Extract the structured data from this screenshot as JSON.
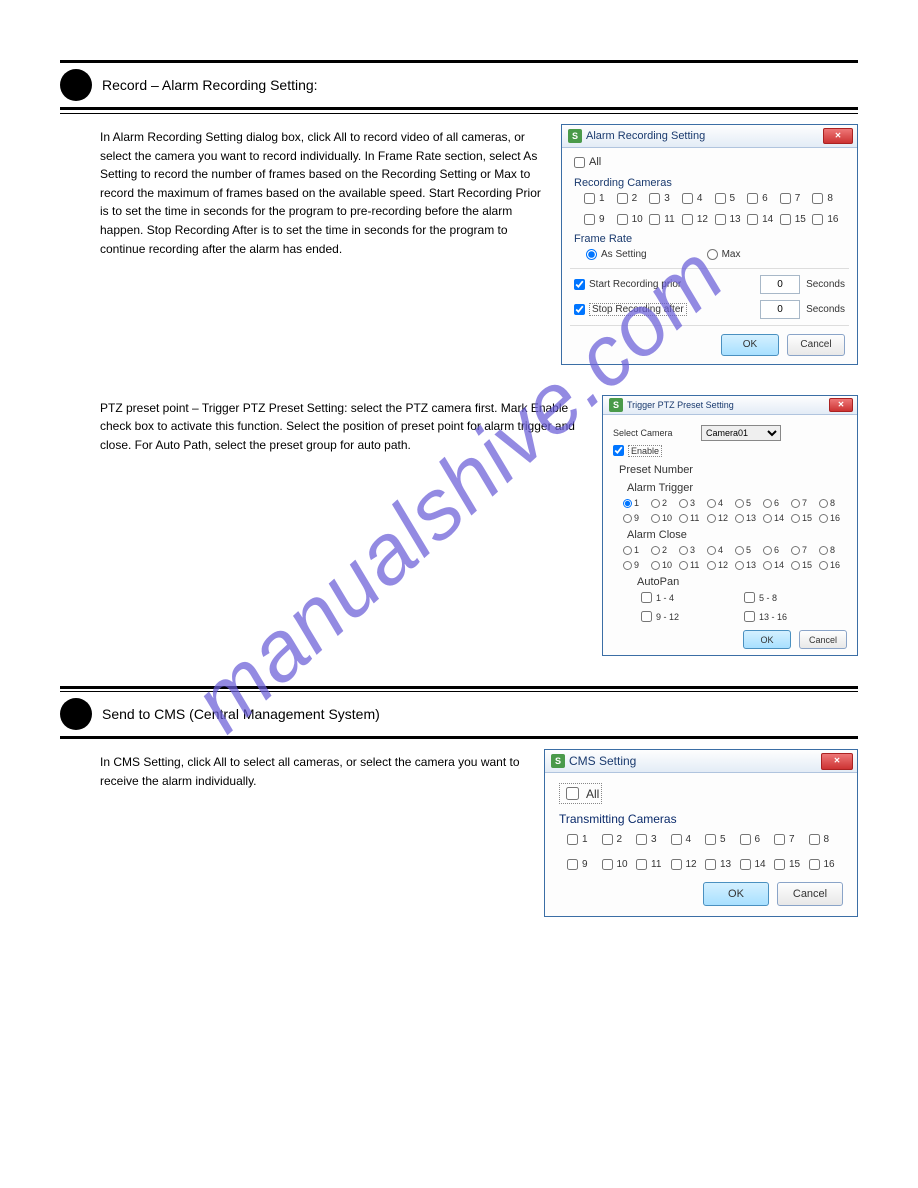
{
  "section1": {
    "title": "Record – Alarm Recording Setting:",
    "body": "In Alarm Recording Setting dialog box, click All to record video of all cameras, or select the camera you want to record individually. In Frame Rate section, select As Setting to record the number of frames based on the Recording Setting or Max to record the maximum of frames based on the available speed. Start Recording Prior is to set the time in seconds for the program to pre-recording before the alarm happen. Stop Recording After is to set the time in seconds for the program to continue recording after the alarm has ended."
  },
  "dlg1": {
    "title": "Alarm Recording Setting",
    "all": "All",
    "rec_cams": "Recording Cameras",
    "cams": [
      "1",
      "2",
      "3",
      "4",
      "5",
      "6",
      "7",
      "8",
      "9",
      "10",
      "11",
      "12",
      "13",
      "14",
      "15",
      "16"
    ],
    "frame_rate": "Frame Rate",
    "as_setting": "As Setting",
    "max": "Max",
    "start_prior": "Start Recording prior",
    "stop_after": "Stop Recording after",
    "start_val": "0",
    "stop_val": "0",
    "seconds": "Seconds",
    "ok": "OK",
    "cancel": "Cancel"
  },
  "ptz": {
    "body": "PTZ preset point – Trigger PTZ Preset Setting: select the PTZ camera first. Mark Enable check box to activate this function. Select the position of preset point for alarm trigger and close. For Auto Path, select the preset group for auto path."
  },
  "dlg2": {
    "title": "Trigger PTZ Preset Setting",
    "select_cam": "Select Camera",
    "cam_value": "Camera01",
    "enable": "Enable",
    "preset_num": "Preset Number",
    "alarm_trigger": "Alarm Trigger",
    "alarm_close": "Alarm Close",
    "nums": [
      "1",
      "2",
      "3",
      "4",
      "5",
      "6",
      "7",
      "8",
      "9",
      "10",
      "11",
      "12",
      "13",
      "14",
      "15",
      "16"
    ],
    "autopan": "AutoPan",
    "ap": [
      "1 - 4",
      "5 - 8",
      "9 - 12",
      "13 - 16"
    ],
    "ok": "OK",
    "cancel": "Cancel"
  },
  "section2": {
    "title": "Send to CMS (Central Management System)",
    "body": "In CMS Setting, click All to select all cameras, or select the camera you want to receive the alarm individually."
  },
  "dlg3": {
    "title": "CMS Setting",
    "all": "All",
    "trans": "Transmitting Cameras",
    "cams": [
      "1",
      "2",
      "3",
      "4",
      "5",
      "6",
      "7",
      "8",
      "9",
      "10",
      "11",
      "12",
      "13",
      "14",
      "15",
      "16"
    ],
    "ok": "OK",
    "cancel": "Cancel"
  },
  "watermark": "manualshive.com"
}
